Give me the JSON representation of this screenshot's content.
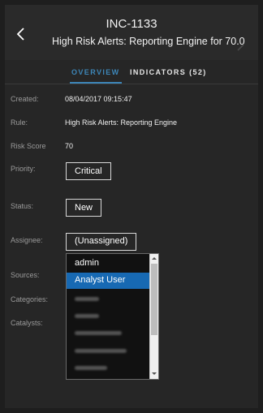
{
  "header": {
    "incident_id": "INC-1133",
    "title": "High Risk Alerts: Reporting Engine for 70.0"
  },
  "tabs": [
    {
      "label": "OVERVIEW",
      "active": true
    },
    {
      "label": "INDICATORS (52)",
      "active": false
    }
  ],
  "details": {
    "created_label": "Created:",
    "created_value": "08/04/2017 09:15:47",
    "rule_label": "Rule:",
    "rule_value": "High Risk Alerts: Reporting Engine",
    "risk_label": "Risk Score",
    "risk_value": "70",
    "priority_label": "Priority:",
    "priority_value": "Critical",
    "status_label": "Status:",
    "status_value": "New",
    "assignee_label": "Assignee:",
    "assignee_value": "(Unassigned)",
    "sources_label": "Sources:",
    "categories_label": "Categories:",
    "catalysts_label": "Catalysts:"
  },
  "assignee_dropdown": {
    "options": [
      {
        "label": "admin",
        "highlighted": false
      },
      {
        "label": "Analyst User",
        "highlighted": true
      }
    ],
    "blurred_option_count": 5
  },
  "colors": {
    "accent": "#3d86b8",
    "selection": "#1769b3",
    "background": "#262626"
  }
}
